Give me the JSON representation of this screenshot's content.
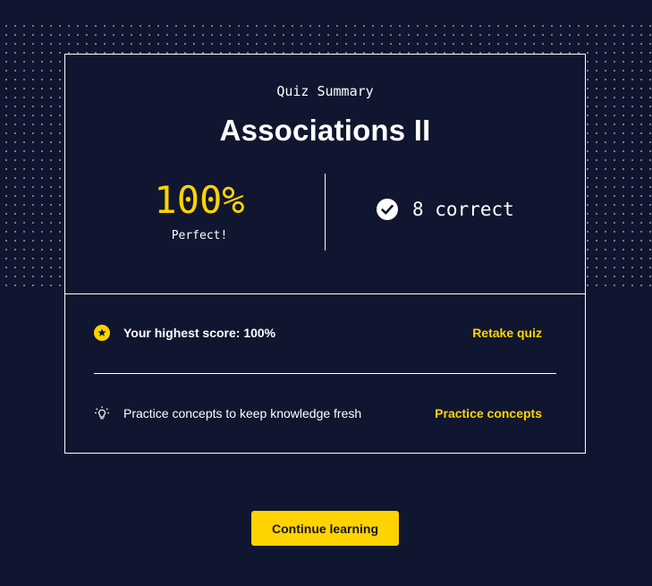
{
  "summary": {
    "subtitle": "Quiz Summary",
    "title": "Associations II",
    "score_percent": "100%",
    "score_label": "Perfect!",
    "correct_text": "8 correct"
  },
  "actions": {
    "highest_score_text": "Your highest score: 100%",
    "retake_label": "Retake quiz",
    "practice_text": "Practice concepts to keep knowledge fresh",
    "practice_label": "Practice concepts",
    "continue_label": "Continue learning"
  },
  "icons": {
    "check": "check-circle-icon",
    "star": "star-badge-icon",
    "lightbulb": "lightbulb-icon"
  },
  "colors": {
    "background": "#10162f",
    "accent": "#ffd300",
    "text": "#ffffff"
  }
}
